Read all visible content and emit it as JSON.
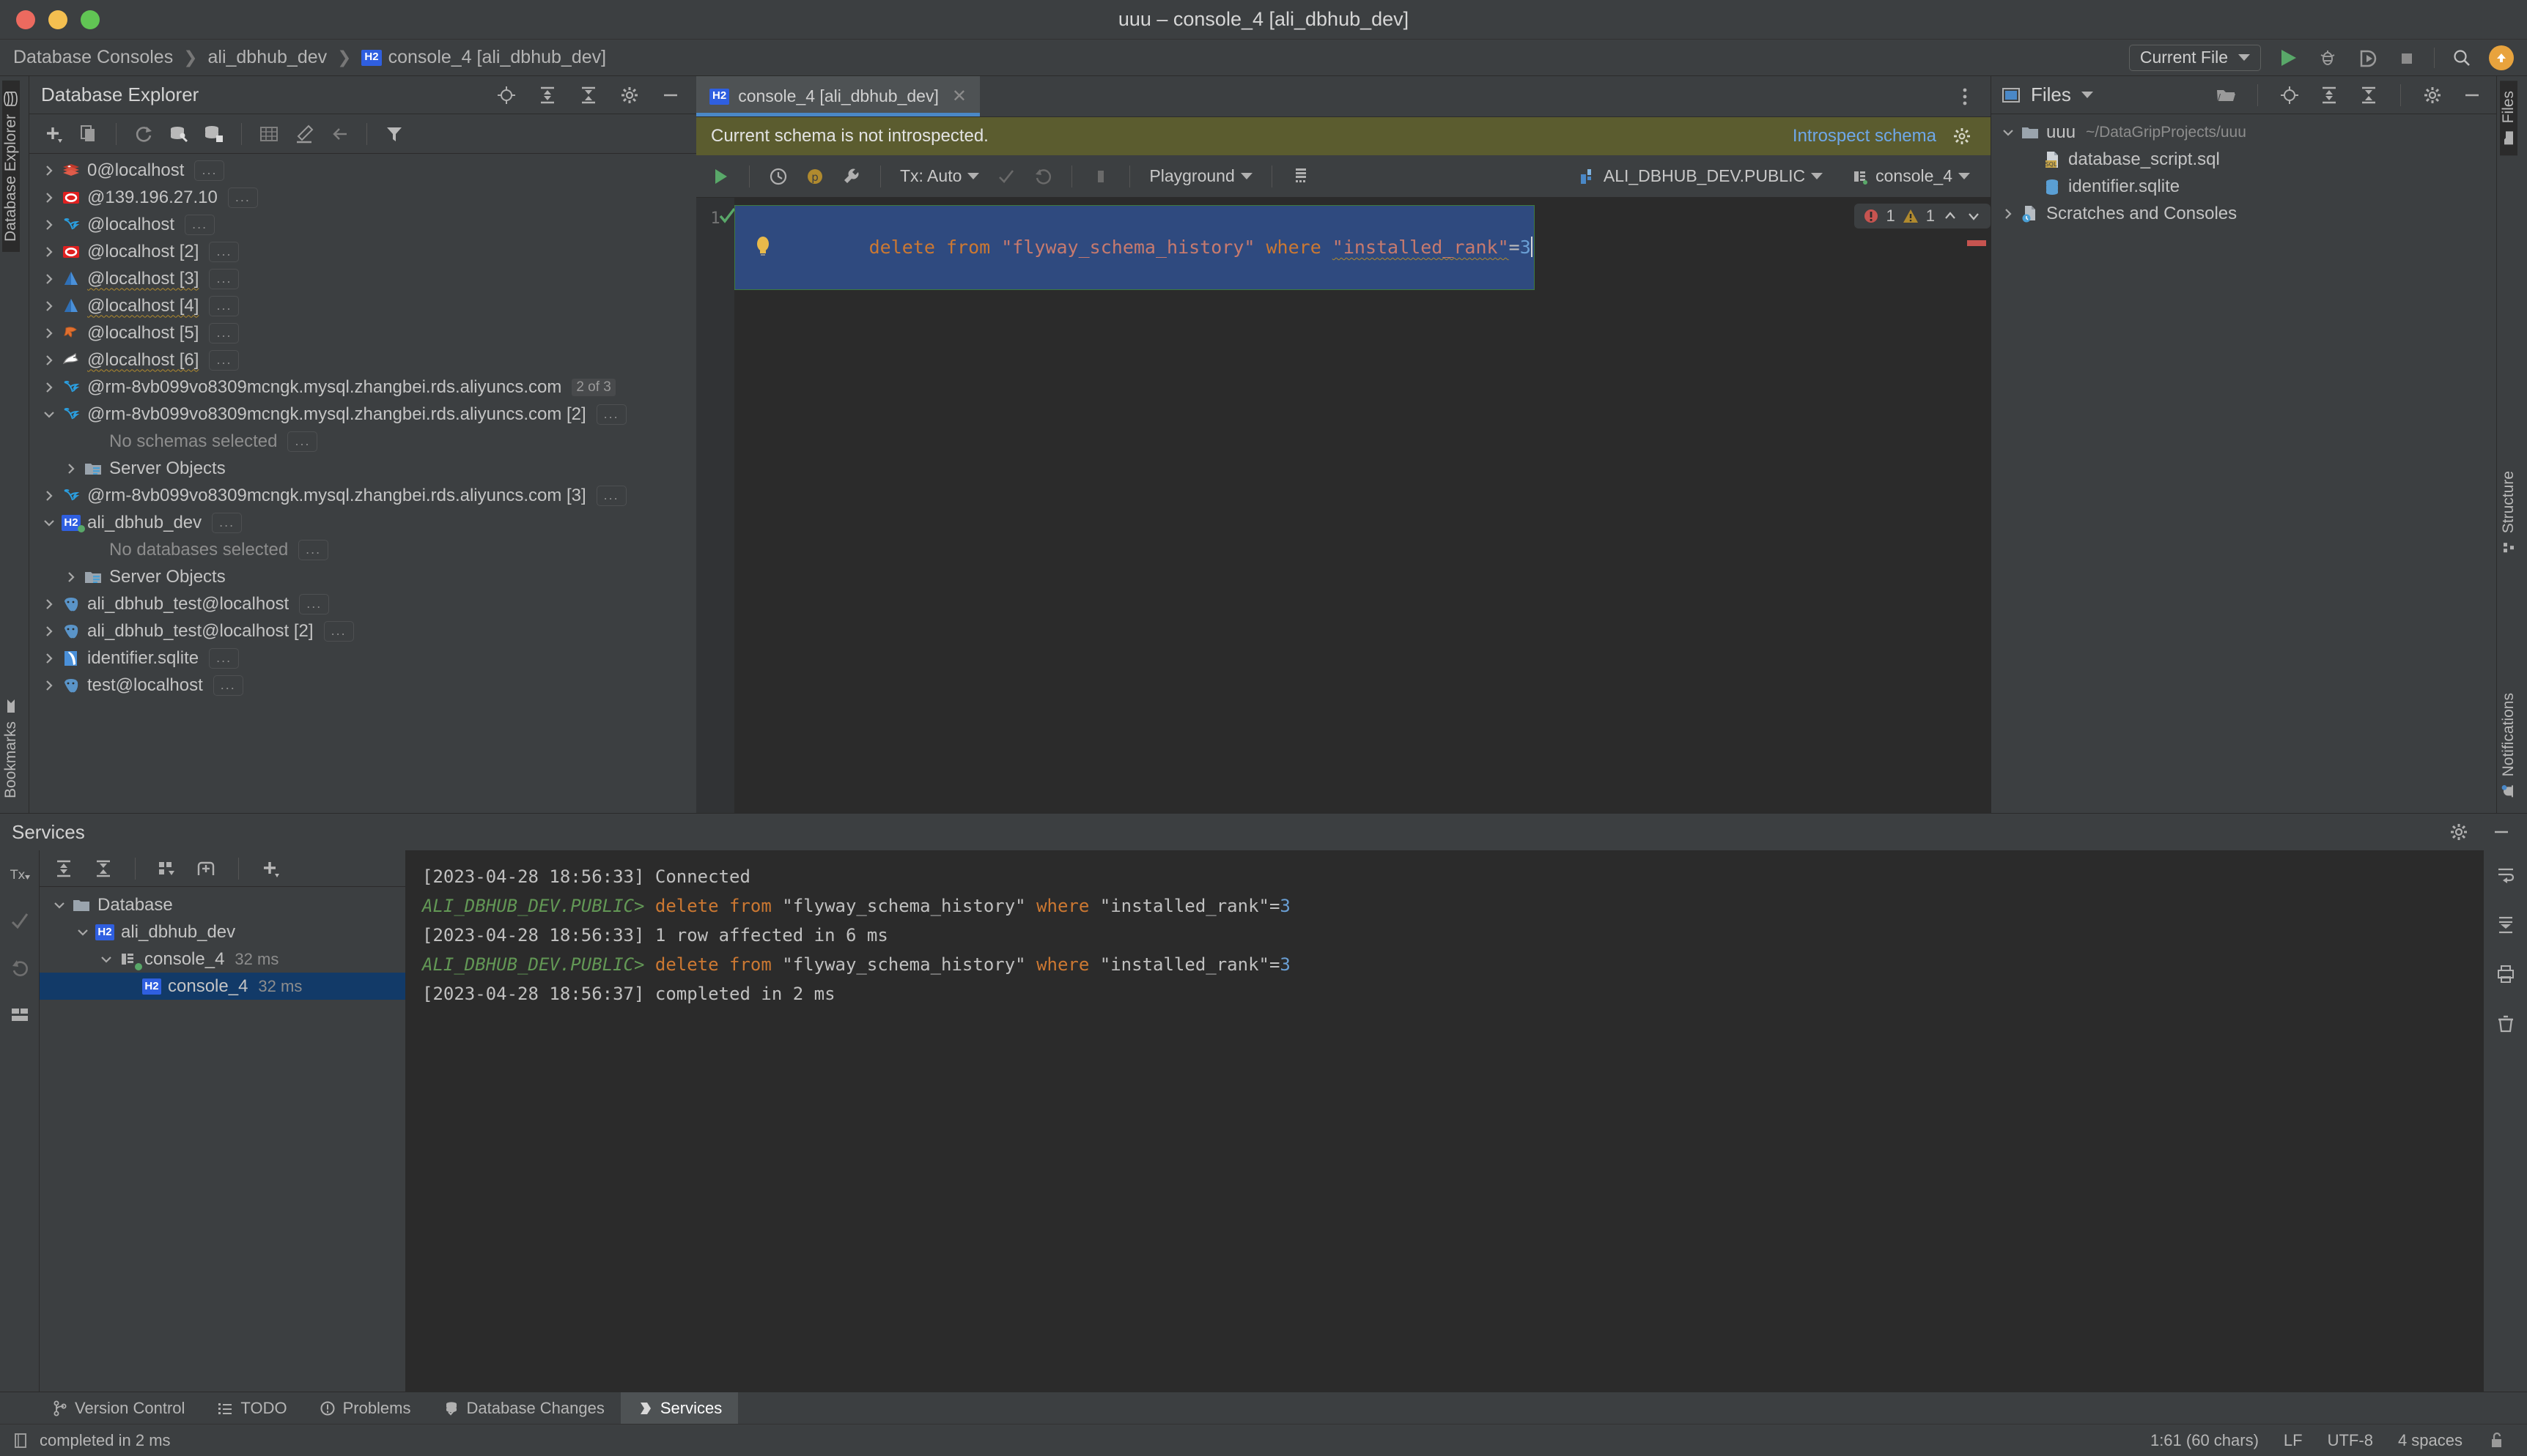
{
  "window": {
    "title": "uuu – console_4 [ali_dbhub_dev]"
  },
  "breadcrumb": {
    "items": [
      "Database Consoles",
      "ali_dbhub_dev",
      "console_4 [ali_dbhub_dev]"
    ],
    "db_badge": "H2"
  },
  "top_toolbar": {
    "run_config": "Current File",
    "run_icon": "run-icon",
    "debug_icon": "debug-icon",
    "run_coverage_icon": "run-with-coverage-icon",
    "stop_icon": "stop-icon",
    "search_icon": "search-icon",
    "update_icon": "update-available-icon"
  },
  "left_strip": {
    "tabs": [
      {
        "label": "Database Explorer",
        "icon": "database-icon",
        "active": true
      },
      {
        "label": "Bookmarks",
        "icon": "bookmark-icon",
        "active": false
      }
    ]
  },
  "right_strip": {
    "tabs": [
      {
        "label": "Files",
        "icon": "folder-icon",
        "active": true
      },
      {
        "label": "Structure",
        "icon": "structure-icon",
        "active": false
      },
      {
        "label": "Notifications",
        "icon": "notifications-icon",
        "active": false
      }
    ]
  },
  "database_explorer": {
    "title": "Database Explorer",
    "toolbar_icons": [
      "add-icon",
      "duplicate-icon",
      "refresh-icon",
      "db-tools-icon",
      "db-schema-icon",
      "table-icon",
      "edit-icon",
      "jump-to-icon",
      "filter-icon"
    ],
    "header_icons": [
      "locate-icon",
      "expand-all-icon",
      "collapse-all-icon",
      "settings-icon",
      "hide-icon"
    ],
    "tree": [
      {
        "label": "0@localhost",
        "icon": "redis-icon",
        "indent": 0,
        "arrow": "collapsed",
        "ellipsis": true
      },
      {
        "label": "@139.196.27.10",
        "icon": "oracle-icon",
        "indent": 0,
        "arrow": "collapsed",
        "ellipsis": true
      },
      {
        "label": "@localhost",
        "icon": "mysql-icon",
        "indent": 0,
        "arrow": "collapsed",
        "ellipsis": true
      },
      {
        "label": "@localhost [2]",
        "icon": "oracle-icon",
        "indent": 0,
        "arrow": "collapsed",
        "ellipsis": true
      },
      {
        "label": "@localhost [3]",
        "icon": "azure-icon",
        "indent": 0,
        "arrow": "collapsed",
        "ellipsis": true,
        "squiggle": true
      },
      {
        "label": "@localhost [4]",
        "icon": "azure-icon",
        "indent": 0,
        "arrow": "collapsed",
        "ellipsis": true,
        "squiggle": true
      },
      {
        "label": "@localhost [5]",
        "icon": "clickhouse-icon",
        "indent": 0,
        "arrow": "collapsed",
        "ellipsis": true
      },
      {
        "label": "@localhost [6]",
        "icon": "mariadb-icon",
        "indent": 0,
        "arrow": "collapsed",
        "ellipsis": true,
        "squiggle": true
      },
      {
        "label": "@rm-8vb099vo8309mcngk.mysql.zhangbei.rds.aliyuncs.com",
        "icon": "mysql-icon",
        "indent": 0,
        "arrow": "collapsed",
        "count": "2 of 3"
      },
      {
        "label": "@rm-8vb099vo8309mcngk.mysql.zhangbei.rds.aliyuncs.com [2]",
        "icon": "mysql-icon",
        "indent": 0,
        "arrow": "expanded",
        "ellipsis": true
      },
      {
        "label": "No schemas selected",
        "icon": "none",
        "indent": 1,
        "arrow": "none",
        "muted": true,
        "ellipsis": true
      },
      {
        "label": "Server Objects",
        "icon": "server-objects-icon",
        "indent": 1,
        "arrow": "collapsed"
      },
      {
        "label": "@rm-8vb099vo8309mcngk.mysql.zhangbei.rds.aliyuncs.com [3]",
        "icon": "mysql-icon",
        "indent": 0,
        "arrow": "collapsed",
        "ellipsis": true
      },
      {
        "label": "ali_dbhub_dev",
        "icon": "h2-icon",
        "indent": 0,
        "arrow": "expanded",
        "ellipsis": true,
        "connected": true
      },
      {
        "label": "No databases selected",
        "icon": "none",
        "indent": 1,
        "arrow": "none",
        "muted": true,
        "ellipsis": true
      },
      {
        "label": "Server Objects",
        "icon": "server-objects-icon",
        "indent": 1,
        "arrow": "collapsed"
      },
      {
        "label": "ali_dbhub_test@localhost",
        "icon": "postgres-icon",
        "indent": 0,
        "arrow": "collapsed",
        "ellipsis": true
      },
      {
        "label": "ali_dbhub_test@localhost [2]",
        "icon": "postgres-icon",
        "indent": 0,
        "arrow": "collapsed",
        "ellipsis": true
      },
      {
        "label": "identifier.sqlite",
        "icon": "sqlite-icon",
        "indent": 0,
        "arrow": "collapsed",
        "ellipsis": true
      },
      {
        "label": "test@localhost",
        "icon": "postgres-icon",
        "indent": 0,
        "arrow": "collapsed",
        "ellipsis": true
      }
    ]
  },
  "editor": {
    "tab": {
      "label": "console_4 [ali_dbhub_dev]",
      "badge": "H2",
      "close_icon": "close-icon"
    },
    "tab_options_icon": "more-options-icon",
    "notification": {
      "message": "Current schema is not introspected.",
      "action": "Introspect schema",
      "settings_icon": "gear-icon",
      "background": "#5b5c2f"
    },
    "toolbar": {
      "execute_icon": "execute-icon",
      "history_icon": "history-icon",
      "params_icon": "parameters-icon",
      "settings_icon": "wrench-icon",
      "tx_label": "Tx: Auto",
      "commit_icon": "commit-icon",
      "rollback_icon": "rollback-icon",
      "stop_icon": "stop-icon",
      "schema_mode": "Playground",
      "grid_icon": "grid-icon",
      "datasource": "ALI_DBHUB_DEV.PUBLIC",
      "session": "console_4"
    },
    "gutter": {
      "line_number": "1",
      "run_mark_icon": "run-success-icon"
    },
    "code": {
      "keyword1": "delete from ",
      "string1": "\"flyway_schema_history\"",
      "keyword2": " where ",
      "string2": "\"installed_rank\"",
      "equals": "=",
      "number": "3"
    },
    "intention_bulb_icon": "intention-bulb-icon",
    "inspections": {
      "error_count": "1",
      "warning_count": "1",
      "error_icon": "error-icon",
      "warning_icon": "warning-icon",
      "prev_icon": "chevron-up-icon",
      "next_icon": "chevron-down-icon"
    }
  },
  "files_panel": {
    "title": "Files",
    "dropdown_icon": "chevron-down-icon",
    "toolbar_icons": [
      "open-folder-icon",
      "locate-icon",
      "expand-all-icon",
      "collapse-all-icon",
      "settings-icon",
      "hide-icon"
    ],
    "tree": [
      {
        "label": "uuu",
        "path": "~/DataGripProjects/uuu",
        "icon": "folder-icon",
        "indent": 0,
        "arrow": "expanded"
      },
      {
        "label": "database_script.sql",
        "icon": "sql-file-icon",
        "indent": 1,
        "arrow": "none"
      },
      {
        "label": "identifier.sqlite",
        "icon": "sqlite-db-icon",
        "indent": 1,
        "arrow": "none"
      },
      {
        "label": "Scratches and Consoles",
        "icon": "scratches-icon",
        "indent": 0,
        "arrow": "collapsed"
      }
    ]
  },
  "services": {
    "title": "Services",
    "header_icons": [
      "settings-icon",
      "hide-icon"
    ],
    "rail_icons": [
      "tx-icon",
      "commit-icon",
      "rollback-icon",
      "layout-icon"
    ],
    "toolbar_icons": [
      "expand-all-icon",
      "collapse-all-icon",
      "group-by-icon",
      "add-tab-icon",
      "add-icon"
    ],
    "tree": [
      {
        "label": "Database",
        "icon": "folder-icon",
        "indent": 0,
        "arrow": "expanded",
        "selected": false
      },
      {
        "label": "ali_dbhub_dev",
        "icon": "h2-icon",
        "indent": 1,
        "arrow": "expanded",
        "selected": false
      },
      {
        "label": "console_4",
        "duration": "32 ms",
        "icon": "console-icon",
        "indent": 2,
        "arrow": "expanded",
        "selected": false,
        "connected": true
      },
      {
        "label": "console_4",
        "duration": "32 ms",
        "icon": "h2-icon",
        "indent": 3,
        "arrow": "none",
        "selected": true
      }
    ],
    "console_lines": [
      {
        "type": "info",
        "text": "[2023-04-28 18:56:33] Connected"
      },
      {
        "type": "query",
        "prompt": "ALI_DBHUB_DEV.PUBLIC>",
        "keyword1": " delete from ",
        "string1": "\"flyway_schema_history\"",
        "keyword2": " where ",
        "string2": "\"installed_rank\"",
        "equals": "=",
        "number": "3"
      },
      {
        "type": "info",
        "text": "[2023-04-28 18:56:33] 1 row affected in 6 ms"
      },
      {
        "type": "query",
        "prompt": "ALI_DBHUB_DEV.PUBLIC>",
        "keyword1": " delete from ",
        "string1": "\"flyway_schema_history\"",
        "keyword2": " where ",
        "string2": "\"installed_rank\"",
        "equals": "=",
        "number": "3"
      },
      {
        "type": "info",
        "text": "[2023-04-28 18:56:37] completed in 2 ms"
      }
    ],
    "console_rail_icons": [
      "soft-wrap-icon",
      "scroll-to-end-icon",
      "print-icon",
      "clear-icon"
    ]
  },
  "bottom_tabs": [
    {
      "label": "Version Control",
      "icon": "branch-icon",
      "active": false
    },
    {
      "label": "TODO",
      "icon": "todo-icon",
      "active": false
    },
    {
      "label": "Problems",
      "icon": "problems-icon",
      "active": false
    },
    {
      "label": "Database Changes",
      "icon": "db-changes-icon",
      "active": false
    },
    {
      "label": "Services",
      "icon": "services-icon",
      "active": true
    }
  ],
  "statusbar": {
    "icon": "console-status-icon",
    "message": "completed in 2 ms",
    "caret_position": "1:61 (60 chars)",
    "line_separator": "LF",
    "encoding": "UTF-8",
    "indent": "4 spaces",
    "lock_icon": "unlocked-icon"
  }
}
